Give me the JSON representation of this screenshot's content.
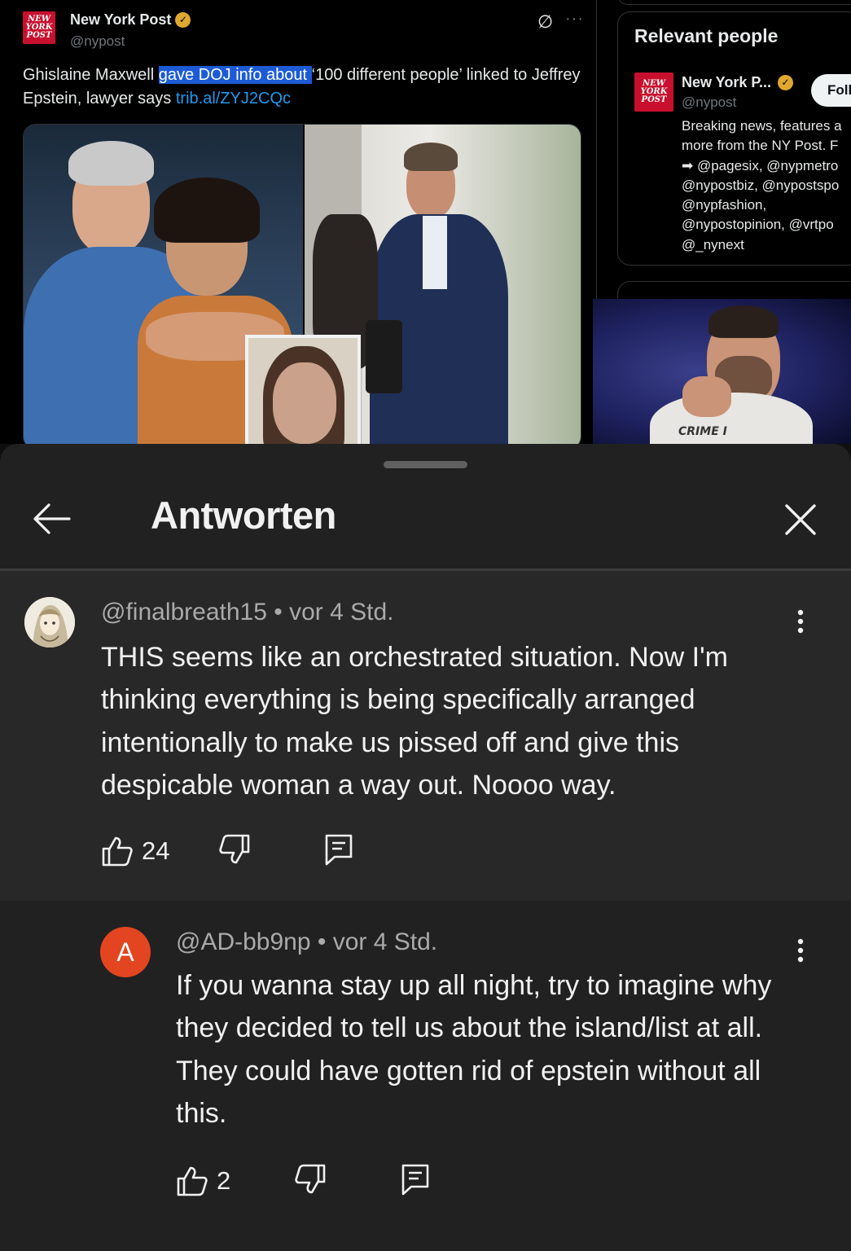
{
  "tweet": {
    "logo_text": "NEW YORK POST",
    "author_name": "New York Post",
    "author_handle": "@nypost",
    "text_before": "Ghislaine Maxwell ",
    "text_highlight": "gave DOJ info about ",
    "text_after": "‘100 different people’ linked to Jeffrey Epstein, lawyer says ",
    "link": "trib.al/ZYJ2CQc",
    "controls": {
      "grok_icon": "∅",
      "more_icon": "···"
    }
  },
  "sidebar": {
    "title": "Relevant people",
    "person": {
      "name": "New York P...",
      "handle": "@nypost",
      "follow_label": "Foll",
      "bio": "Breaking news, features a\nmore from the NY Post. F\n➡ @pagesix, @nypmetro\n@nypostbiz, @nypostspo\n@nypfashion,\n@nypostopinion, @vrtpo\n@_nynext"
    }
  },
  "webcam": {
    "shirt_text": "CRIME I"
  },
  "sheet": {
    "title": "Antworten",
    "back_icon": "arrow-left-icon",
    "close_icon": "close-icon"
  },
  "comments": [
    {
      "author": "@finalbreath15",
      "time": "vor 4 Std.",
      "meta": "@finalbreath15 • vor 4 Std.",
      "text": "THIS seems like an orchestrated situation. Now I'm thinking everything is being specifically arranged intentionally to make us pissed off and give this despicable woman a way out. Noooo way.",
      "likes": "24",
      "avatar_type": "anime-illustration"
    },
    {
      "author": "@AD-bb9np",
      "time": "vor 4 Std.",
      "meta": "@AD-bb9np • vor 4 Std.",
      "text": "If you wanna stay up all night, try to imagine why they decided to tell us about the island/list at all. They could have gotten rid of epstein without all this.",
      "likes": "2",
      "avatar_letter": "A",
      "avatar_color": "#e2451f"
    }
  ],
  "colors": {
    "sheet_bg": "#212121",
    "highlighted_comment_bg": "#282828",
    "twitter_link": "#1d9bf0",
    "verified_gold": "#e0a82e",
    "nypost_red": "#c8102e"
  }
}
